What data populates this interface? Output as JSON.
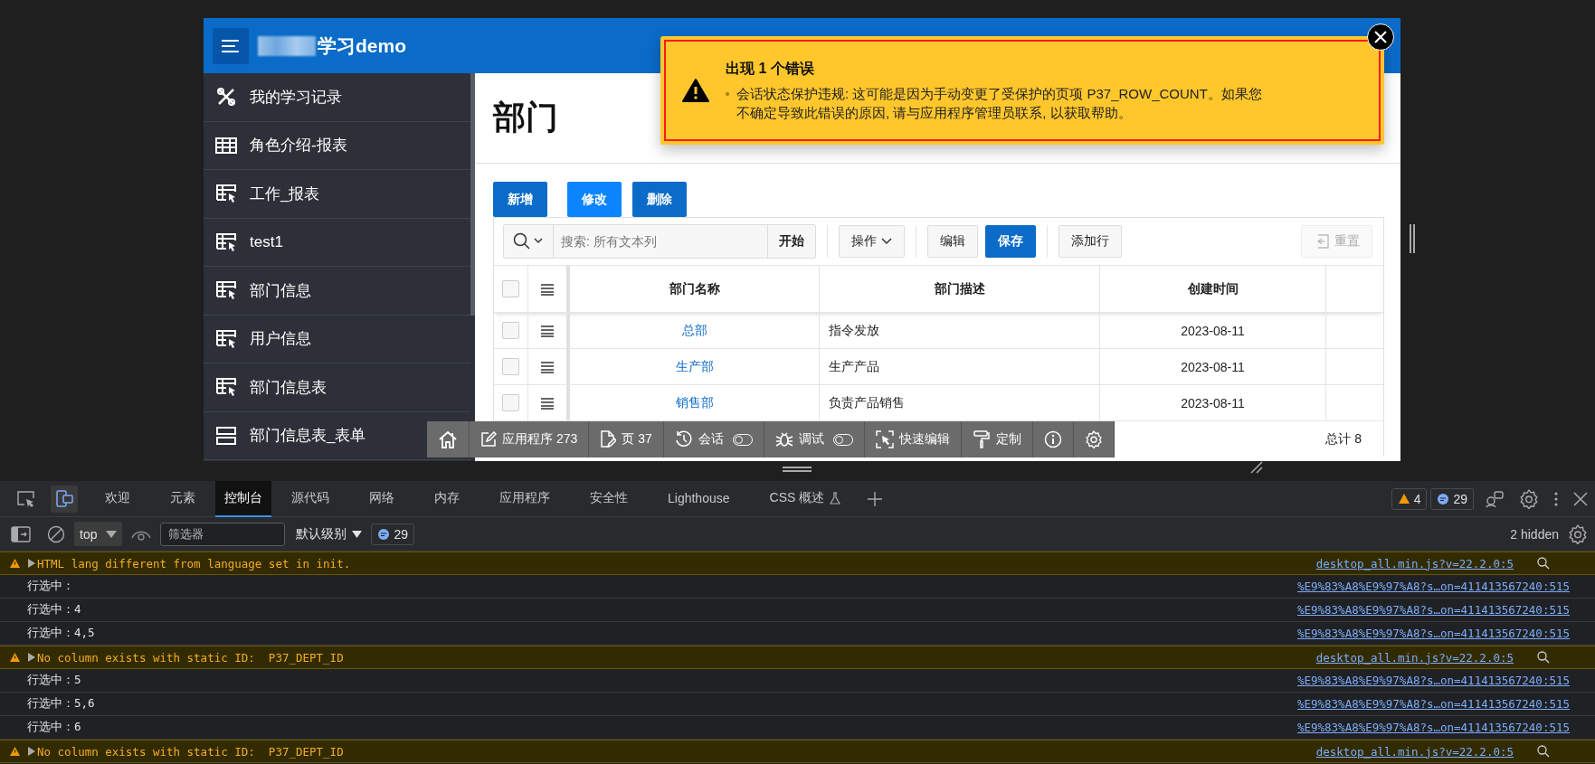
{
  "app": {
    "title": "学习demo",
    "menu": [
      {
        "label": "我的学习记录",
        "kind": "tools"
      },
      {
        "label": "角色介绍-报表",
        "kind": "table"
      },
      {
        "label": "工作_报表",
        "kind": "report"
      },
      {
        "label": "test1",
        "kind": "report"
      },
      {
        "label": "部门信息",
        "kind": "report"
      },
      {
        "label": "用户信息",
        "kind": "report"
      },
      {
        "label": "部门信息表",
        "kind": "report"
      },
      {
        "label": "部门信息表_表单",
        "kind": "form"
      }
    ],
    "page_title": "部门",
    "buttons": [
      {
        "label": "新增",
        "kind": "primary"
      },
      {
        "label": "修改",
        "kind": "hot"
      },
      {
        "label": "删除",
        "kind": "primary"
      }
    ],
    "grid_toolbar": {
      "search_placeholder": "搜索: 所有文本列",
      "go": "开始",
      "actions": "操作",
      "edit": "编辑",
      "save": "保存",
      "add_row": "添加行",
      "reset": {
        "label": "重置",
        "disabled": true
      }
    },
    "table": {
      "select_all_checked": false,
      "columns": [
        "部门名称",
        "部门描述",
        "创建时间"
      ],
      "rows": [
        {
          "checked": false,
          "name": "总部",
          "description": "指令发放",
          "created": "2023-08-11"
        },
        {
          "checked": false,
          "name": "生产部",
          "description": "生产产品",
          "created": "2023-08-11"
        },
        {
          "checked": false,
          "name": "销售部",
          "description": "负责产品销售",
          "created": "2023-08-11"
        }
      ],
      "total": "总计 8"
    },
    "error": {
      "title": "出现 1 个错误",
      "message": "会话状态保护违规: 这可能是因为手动变更了受保护的页项 P37_ROW_COUNT。如果您不确定导致此错误的原因, 请与应用程序管理员联系, 以获取帮助。"
    },
    "dev_toolbar": [
      {
        "kind": "home"
      },
      {
        "kind": "app",
        "label": "应用程序 273"
      },
      {
        "kind": "page",
        "label": "页 37"
      },
      {
        "kind": "session",
        "label": "会话",
        "on": false
      },
      {
        "kind": "debug",
        "label": "调试",
        "on": false
      },
      {
        "kind": "quick_edit",
        "label": "快速编辑"
      },
      {
        "kind": "customize",
        "label": "定制"
      },
      {
        "kind": "info"
      },
      {
        "kind": "settings"
      }
    ]
  },
  "devtools": {
    "tabs": [
      {
        "label": "欢迎",
        "selected": false
      },
      {
        "label": "元素",
        "selected": false
      },
      {
        "label": "控制台",
        "selected": true
      },
      {
        "label": "源代码",
        "selected": false
      },
      {
        "label": "网络",
        "selected": false
      },
      {
        "label": "内存",
        "selected": false
      },
      {
        "label": "应用程序",
        "selected": false
      },
      {
        "label": "安全性",
        "selected": false
      },
      {
        "label": "Lighthouse",
        "selected": false
      },
      {
        "label": "CSS 概述",
        "selected": false
      }
    ],
    "warnings": "4",
    "messages": "29",
    "context": "top",
    "filter_placeholder": "筛选器",
    "level": "默认级别",
    "level_messages": "29",
    "hidden": "2 hidden",
    "console": [
      {
        "kind": "warning",
        "text": "HTML lang different from language set in init.",
        "source": "desktop_all.min.js?v=22.2.0:5"
      },
      {
        "kind": "log",
        "text": "行选中：",
        "source": "%E9%83%A8%E9%97%A8?s…on=411413567240:515"
      },
      {
        "kind": "log",
        "text": "行选中：4",
        "source": "%E9%83%A8%E9%97%A8?s…on=411413567240:515"
      },
      {
        "kind": "log",
        "text": "行选中：4,5",
        "source": "%E9%83%A8%E9%97%A8?s…on=411413567240:515"
      },
      {
        "kind": "warning",
        "text": "No column exists with static ID:  P37_DEPT_ID",
        "source": "desktop_all.min.js?v=22.2.0:5"
      },
      {
        "kind": "log",
        "text": "行选中：5",
        "source": "%E9%83%A8%E9%97%A8?s…on=411413567240:515"
      },
      {
        "kind": "log",
        "text": "行选中：5,6",
        "source": "%E9%83%A8%E9%97%A8?s…on=411413567240:515"
      },
      {
        "kind": "log",
        "text": "行选中：6",
        "source": "%E9%83%A8%E9%97%A8?s…on=411413567240:515"
      },
      {
        "kind": "warning",
        "text": "No column exists with static ID:  P37_DEPT_ID",
        "source": "desktop_all.min.js?v=22.2.0:5"
      }
    ]
  }
}
